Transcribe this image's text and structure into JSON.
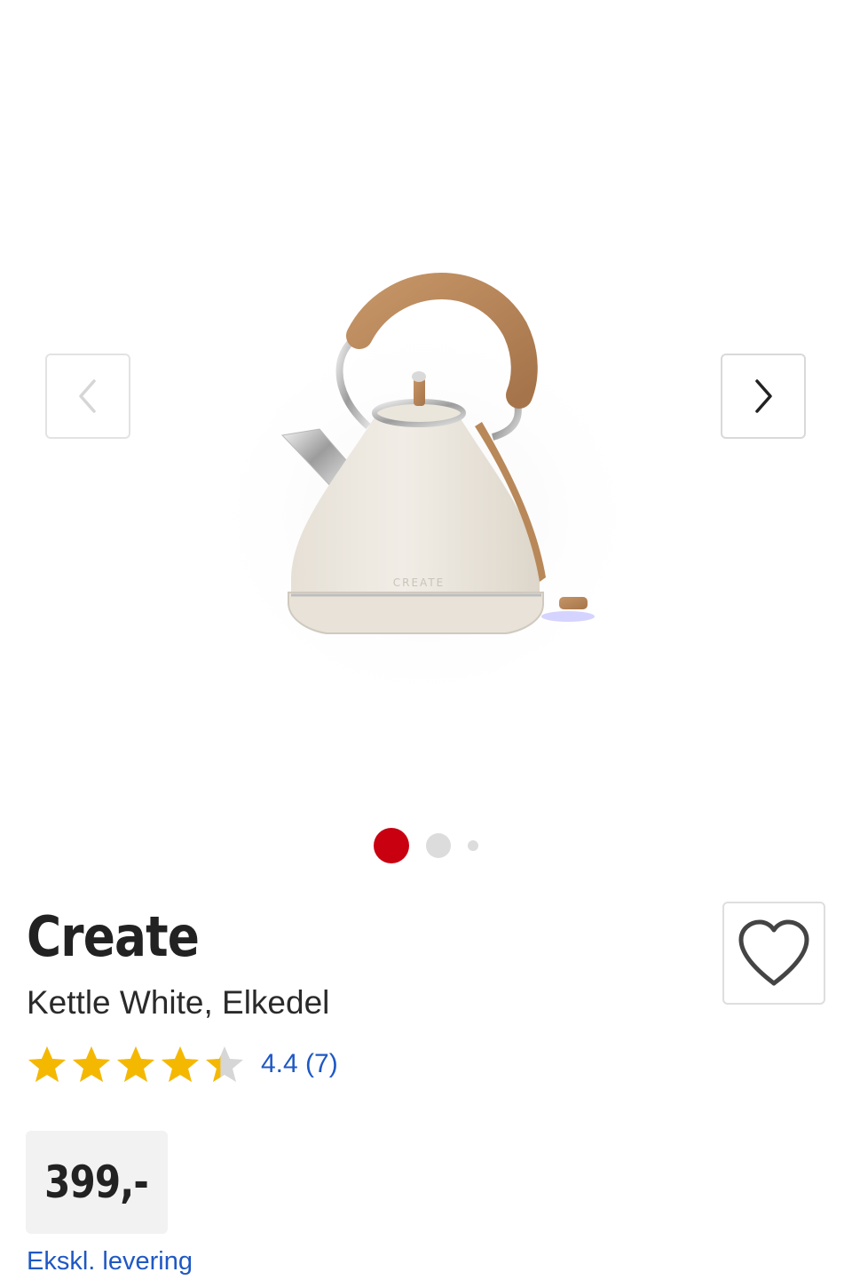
{
  "gallery": {
    "image_alt": "Kettle White, Elkedel",
    "image_logo_text": "CREATE",
    "prev_icon": "chevron-left-icon",
    "next_icon": "chevron-right-icon",
    "slide_count": 3,
    "active_slide": 1
  },
  "product": {
    "brand": "Create",
    "name": "Kettle White, Elkedel",
    "rating_value": 4.4,
    "rating_max": 5,
    "rating_text": "4.4 (7)",
    "favorite_icon": "heart-outline-icon"
  },
  "price": {
    "amount": "399,-",
    "delivery_note": "Ekskl. levering"
  },
  "colors": {
    "accent_red": "#c8000f",
    "link_blue": "#1f58c4",
    "star_gold": "#f5b800",
    "star_empty": "#d6d6d6"
  }
}
